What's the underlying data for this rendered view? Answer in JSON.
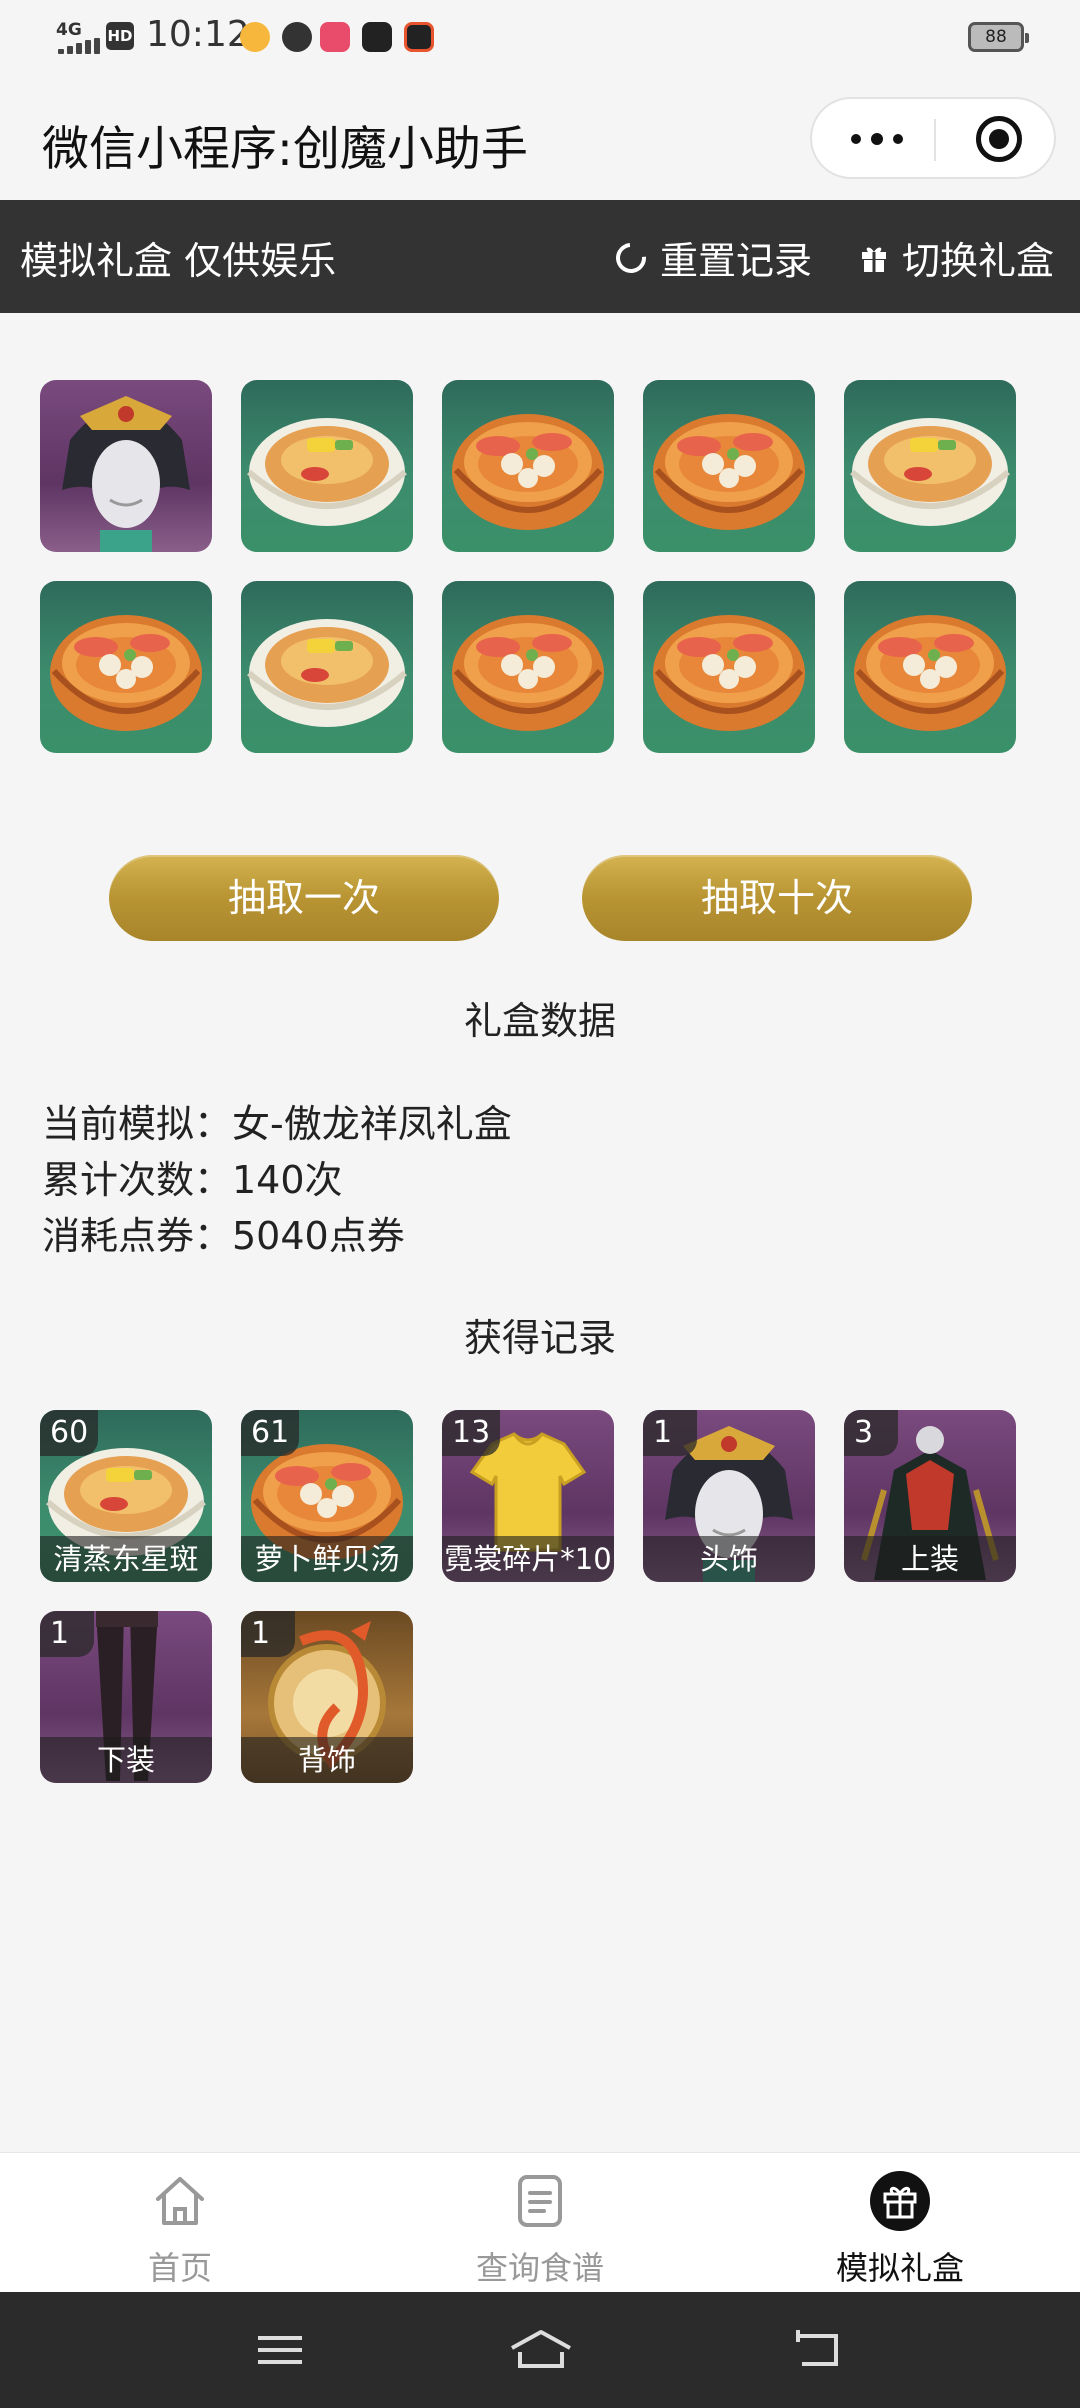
{
  "status_bar": {
    "network": "4G",
    "hd": "HD",
    "time": "10:12",
    "battery": "88"
  },
  "title_bar": {
    "title": "微信小程序:创魔小助手"
  },
  "header": {
    "title": "模拟礼盒 仅供娱乐",
    "reset_label": "重置记录",
    "switch_label": "切换礼盒"
  },
  "draw_results": [
    {
      "icon": "headwear-icon",
      "bg": "purple"
    },
    {
      "icon": "steamed-fish-dish-icon",
      "bg": "green"
    },
    {
      "icon": "scallop-soup-icon",
      "bg": "green"
    },
    {
      "icon": "scallop-soup-icon",
      "bg": "green"
    },
    {
      "icon": "steamed-fish-dish-icon",
      "bg": "green"
    },
    {
      "icon": "scallop-soup-icon",
      "bg": "green"
    },
    {
      "icon": "steamed-fish-dish-icon",
      "bg": "green"
    },
    {
      "icon": "scallop-soup-icon",
      "bg": "green"
    },
    {
      "icon": "scallop-soup-icon",
      "bg": "green"
    },
    {
      "icon": "scallop-soup-icon",
      "bg": "green"
    }
  ],
  "buttons": {
    "draw_once": "抽取一次",
    "draw_ten": "抽取十次"
  },
  "stats": {
    "section_title": "礼盒数据",
    "current": "当前模拟：女-傲龙祥凤礼盒",
    "count": "累计次数：140次",
    "cost": "消耗点券：5040点券"
  },
  "records": {
    "section_title": "获得记录",
    "items": [
      {
        "count": "60",
        "label": "清蒸东星斑",
        "icon": "steamed-fish-dish-icon",
        "bg": "green"
      },
      {
        "count": "61",
        "label": "萝卜鲜贝汤",
        "icon": "scallop-soup-icon",
        "bg": "green"
      },
      {
        "count": "13",
        "label": "霓裳碎片*10",
        "icon": "shirt-fragment-icon",
        "bg": "purple"
      },
      {
        "count": "1",
        "label": "头饰",
        "icon": "headwear-icon",
        "bg": "purple"
      },
      {
        "count": "3",
        "label": "上装",
        "icon": "top-outfit-icon",
        "bg": "purple"
      },
      {
        "count": "1",
        "label": "下装",
        "icon": "bottom-outfit-icon",
        "bg": "purple"
      },
      {
        "count": "1",
        "label": "背饰",
        "icon": "back-accessory-icon",
        "bg": "gold"
      }
    ]
  },
  "tabs": [
    {
      "label": "首页",
      "icon": "home-icon",
      "active": false
    },
    {
      "label": "查询食谱",
      "icon": "recipe-list-icon",
      "active": false
    },
    {
      "label": "模拟礼盒",
      "icon": "gift-box-icon",
      "active": true
    }
  ],
  "colors": {
    "header_bg": "#333333",
    "button_gold": "#b89433",
    "page_bg": "#f5f5f5",
    "nav_bg": "#2b2b2b"
  }
}
